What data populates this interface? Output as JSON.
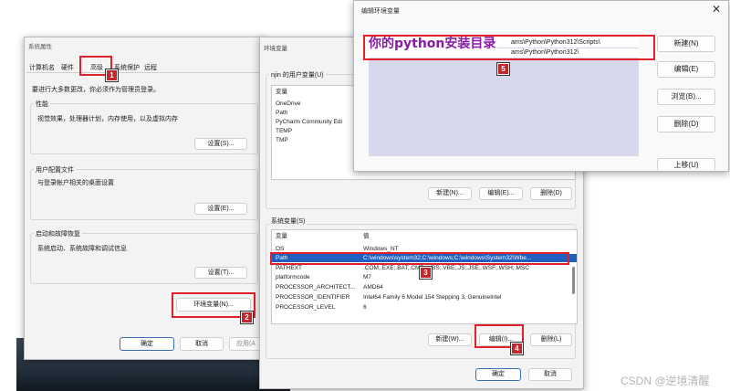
{
  "sys_props": {
    "title": "系统属性",
    "tabs": [
      "计算机名",
      "硬件",
      "高级",
      "系统保护",
      "远程"
    ],
    "admin_note": "要进行大多数更改，你必须作为管理员登录。",
    "performance": {
      "label": "性能",
      "desc": "视觉效果，处理器计划，内存使用，以及虚拟内存",
      "button": "设置(S)..."
    },
    "profiles": {
      "label": "用户配置文件",
      "desc": "与登录帐户相关的桌面设置",
      "button": "设置(E)..."
    },
    "startup": {
      "label": "启动和故障恢复",
      "desc": "系统启动、系统故障和调试信息",
      "button": "设置(T)..."
    },
    "env_button": "环境变量(N)...",
    "ok": "确定",
    "cancel": "取消",
    "apply": "应用(A"
  },
  "env_vars": {
    "title": "环境变量",
    "user_group": "njin 的用户变量(U)",
    "user_header": "变量",
    "user_rows": [
      "OneDrive",
      "Path",
      "PyCharm Community Edi",
      "TEMP",
      "TMP"
    ],
    "user_buttons": [
      "新建(N)...",
      "编辑(E)...",
      "删除(D)"
    ],
    "sys_group": "系统变量(S)",
    "sys_headers": [
      "变量",
      "值"
    ],
    "sys_rows": [
      {
        "name": "OS",
        "value": "Windows_NT"
      },
      {
        "name": "Path",
        "value": "C:\\windows\\system32;C:\\windows;C:\\windows\\System32\\Wbe..."
      },
      {
        "name": "PATHEXT",
        "value": ".COM;.EXE;.BAT;.CMD;.VBS;.VBE;.JS;.JSE;.WSF;.WSH;.MSC"
      },
      {
        "name": "platformcode",
        "value": "M7"
      },
      {
        "name": "PROCESSOR_ARCHITECT...",
        "value": "AMD64"
      },
      {
        "name": "PROCESSOR_IDENTIFIER",
        "value": "Intel64 Family 6 Model 154 Stepping 3, GenuineIntel"
      },
      {
        "name": "PROCESSOR_LEVEL",
        "value": "6"
      }
    ],
    "sys_buttons": [
      "新建(W)...",
      "编辑(I)...",
      "删除(L)"
    ],
    "ok": "确定",
    "cancel": "取消"
  },
  "edit_env": {
    "title": "编辑环境变量",
    "close": "✕",
    "entries": [
      "ams\\Python\\Python312\\Scripts\\",
      "ams\\Python\\Python312\\"
    ],
    "annotation": "你的python安装目录",
    "buttons": [
      "新建(N)",
      "编辑(E)",
      "浏览(B)...",
      "删除(D)",
      "上移(U)"
    ]
  },
  "badges": [
    "1",
    "2",
    "3",
    "4",
    "5"
  ],
  "watermark": "CSDN @逆境清醒"
}
